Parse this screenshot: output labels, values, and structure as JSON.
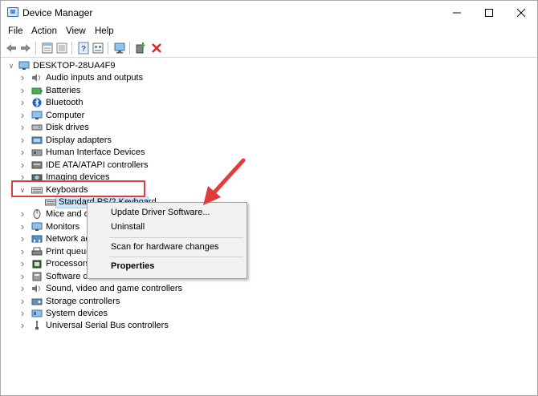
{
  "window": {
    "title": "Device Manager"
  },
  "menu": [
    "File",
    "Action",
    "View",
    "Help"
  ],
  "toolbar": [
    "back-icon",
    "forward-icon",
    "properties-sheet-icon",
    "show-hidden-icon",
    "help-icon",
    "view-icon",
    "monitor-icon",
    "add-driver-icon",
    "uninstall-x-icon"
  ],
  "tree": {
    "root": "DESKTOP-28UA4F9",
    "items": [
      {
        "label": "Audio inputs and outputs",
        "icon": "speaker-icon"
      },
      {
        "label": "Batteries",
        "icon": "battery-icon"
      },
      {
        "label": "Bluetooth",
        "icon": "bluetooth-icon"
      },
      {
        "label": "Computer",
        "icon": "computer-icon"
      },
      {
        "label": "Disk drives",
        "icon": "disk-drive-icon"
      },
      {
        "label": "Display adapters",
        "icon": "display-adapter-icon"
      },
      {
        "label": "Human Interface Devices",
        "icon": "hid-icon"
      },
      {
        "label": "IDE ATA/ATAPI controllers",
        "icon": "ide-controller-icon"
      },
      {
        "label": "Imaging devices",
        "icon": "camera-icon"
      },
      {
        "label": "Keyboards",
        "icon": "keyboard-icon"
      },
      {
        "label": "Mice and ot",
        "icon": "mouse-icon"
      },
      {
        "label": "Monitors",
        "icon": "monitor-icon"
      },
      {
        "label": "Network ad",
        "icon": "network-adapter-icon"
      },
      {
        "label": "Print queue",
        "icon": "printer-icon"
      },
      {
        "label": "Processors",
        "icon": "processor-icon"
      },
      {
        "label": "Software devices",
        "icon": "software-device-icon"
      },
      {
        "label": "Sound, video and game controllers",
        "icon": "sound-icon"
      },
      {
        "label": "Storage controllers",
        "icon": "storage-controller-icon"
      },
      {
        "label": "System devices",
        "icon": "system-device-icon"
      },
      {
        "label": "Universal Serial Bus controllers",
        "icon": "usb-icon"
      }
    ],
    "child_keyboard": "Standard PS/2 Keyboard"
  },
  "context_menu": {
    "update": "Update Driver Software...",
    "uninstall": "Uninstall",
    "scan": "Scan for hardware changes",
    "properties": "Properties"
  },
  "colors": {
    "annotation_red": "#e23b3b",
    "selection_bg": "#cce8ff",
    "close_x_red": "#d9262c"
  }
}
